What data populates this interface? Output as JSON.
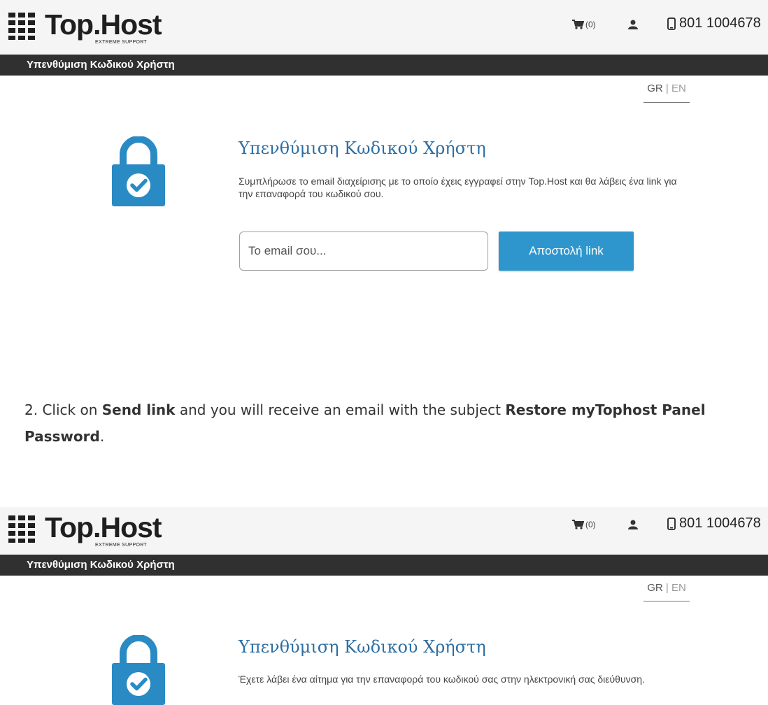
{
  "shots": [
    {
      "brand": {
        "name": "Top.Host",
        "tagline": "EXTREME SUPPORT"
      },
      "header": {
        "cart_count": "(0)",
        "phone": "801 1004678"
      },
      "titlebar": "Υπενθύμιση Κωδικού Χρήστη",
      "lang": {
        "gr": "GR",
        "sep": "|",
        "en": "EN"
      },
      "content": {
        "title": "Υπενθύμιση Κωδικού Χρήστη",
        "description": "Συμπλήρωσε το email διαχείρισης με το οποίο έχεις εγγραφεί στην Top.Host και θα λάβεις ένα link για την επαναφορά του κωδικού σου.",
        "email_placeholder": "Το email σου...",
        "button": "Αποστολή link"
      }
    },
    {
      "brand": {
        "name": "Top.Host",
        "tagline": "EXTREME SUPPORT"
      },
      "header": {
        "cart_count": "(0)",
        "phone": "801 1004678"
      },
      "titlebar": "Υπενθύμιση Κωδικού Χρήστη",
      "lang": {
        "gr": "GR",
        "sep": "|",
        "en": "EN"
      },
      "content": {
        "title": "Υπενθύμιση Κωδικού Χρήστη",
        "description": "Έχετε λάβει ένα αίτημα για την επαναφορά του κωδικού σας στην ηλεκτρονική σας διεύθυνση."
      }
    }
  ],
  "step": {
    "prefix": "2. Click on ",
    "link_label": "Send link",
    "middle": " and you will receive an email with the subject ",
    "subject": "Restore myTophost Panel Password",
    "suffix": "."
  },
  "colors": {
    "accent": "#2e96cc",
    "title_blue": "#2f6fa2",
    "titlebar": "#303030",
    "lock_blue": "#2a8ac4"
  },
  "icons": [
    "cart-icon",
    "user-icon",
    "phone-icon",
    "lock-check-icon"
  ]
}
